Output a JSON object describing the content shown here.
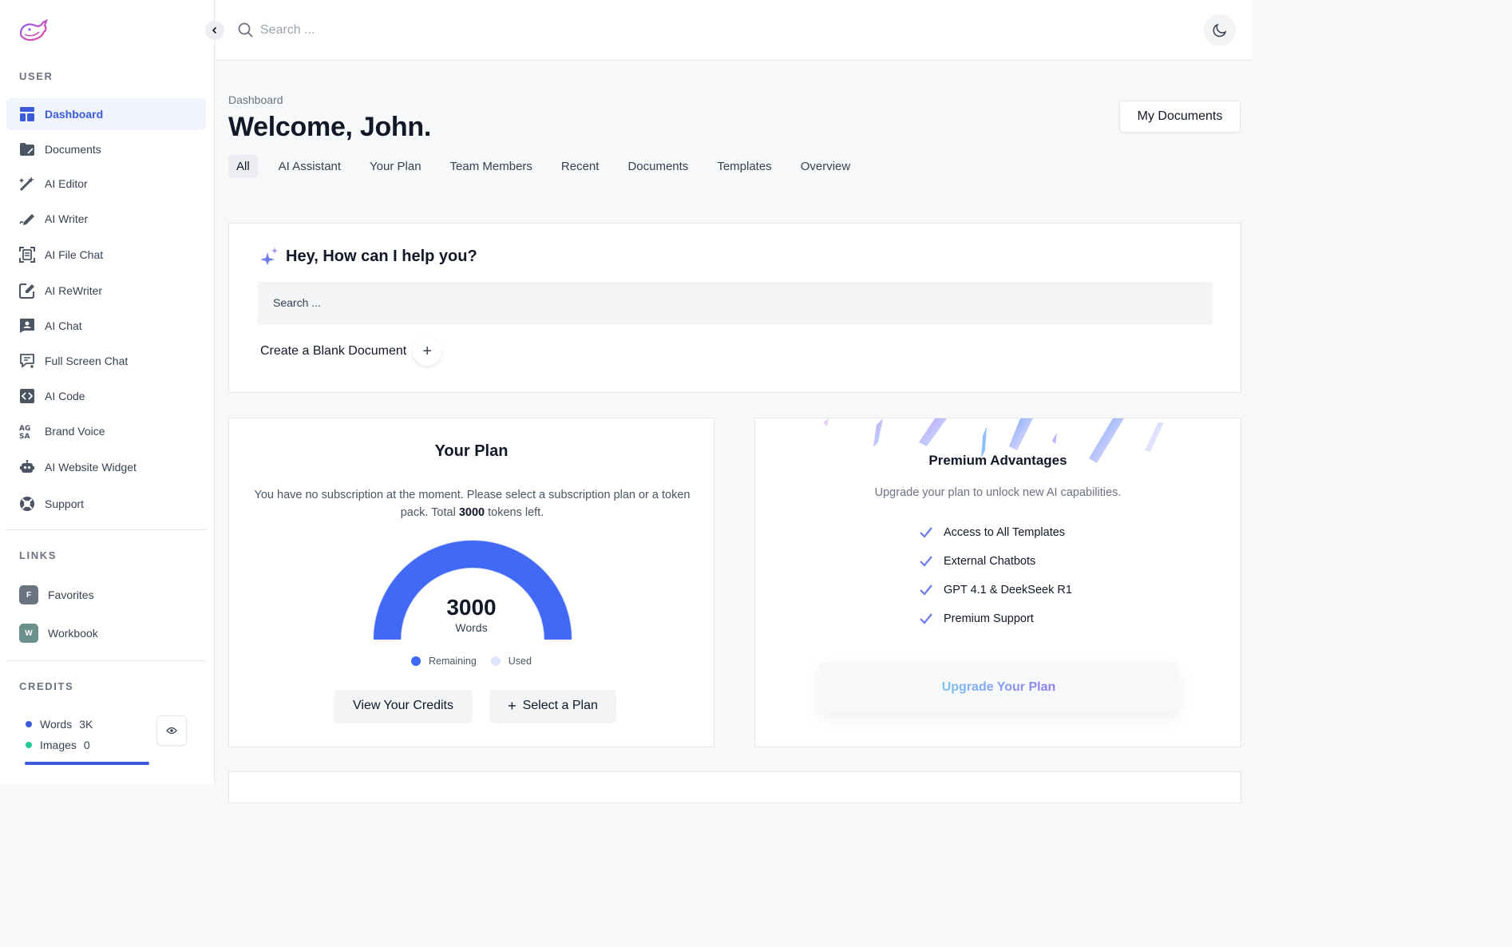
{
  "sidebar": {
    "user_label": "USER",
    "items": [
      {
        "label": "Dashboard",
        "icon": "dashboard-icon"
      },
      {
        "label": "Documents",
        "icon": "folder-icon"
      },
      {
        "label": "AI Editor",
        "icon": "magic-wand-icon"
      },
      {
        "label": "AI Writer",
        "icon": "pen-icon"
      },
      {
        "label": "AI File Chat",
        "icon": "file-scan-icon"
      },
      {
        "label": "AI ReWriter",
        "icon": "edit-icon"
      },
      {
        "label": "AI Chat",
        "icon": "chat-user-icon"
      },
      {
        "label": "Full Screen Chat",
        "icon": "chat-plus-icon"
      },
      {
        "label": "AI Code",
        "icon": "code-icon"
      },
      {
        "label": "Brand Voice",
        "icon": "typography-icon"
      },
      {
        "label": "AI Website Widget",
        "icon": "robot-icon"
      },
      {
        "label": "Support",
        "icon": "lifebuoy-icon"
      }
    ],
    "links_label": "LINKS",
    "links": [
      {
        "letter": "F",
        "label": "Favorites",
        "color": "#6b7280"
      },
      {
        "letter": "W",
        "label": "Workbook",
        "color": "#6b8f8a"
      }
    ],
    "credits_label": "CREDITS",
    "credits": [
      {
        "label": "Words",
        "value": "3K",
        "color": "#3b5bdb"
      },
      {
        "label": "Images",
        "value": "0",
        "color": "#20c997"
      }
    ],
    "credit_progress": 1.0
  },
  "header": {
    "search_placeholder": "Search ..."
  },
  "main": {
    "breadcrumb": "Dashboard",
    "title": "Welcome, John.",
    "my_documents_label": "My Documents",
    "tabs": [
      "All",
      "AI Assistant",
      "Your Plan",
      "Team Members",
      "Recent",
      "Documents",
      "Templates",
      "Overview"
    ]
  },
  "help": {
    "title": "Hey, How can I help you?",
    "search_placeholder": "Search ...",
    "blank_doc_label": "Create a Blank Document"
  },
  "plan": {
    "title": "Your Plan",
    "desc_1": "You have no subscription at the moment. Please select a subscription plan or a token pack. Total ",
    "tokens": "3000",
    "desc_2": " tokens left.",
    "gauge_value": "3000",
    "gauge_unit": "Words",
    "remaining_fraction": 1.0,
    "legend_remaining": "Remaining",
    "legend_used": "Used",
    "remaining_color": "#4169f5",
    "used_color": "#dde4fd",
    "view_credits_label": "View Your Credits",
    "select_plan_label": "Select a Plan"
  },
  "advantages": {
    "title": "Premium Advantages",
    "subtitle": "Upgrade your plan to unlock new AI capabilities.",
    "items": [
      "Access to All Templates",
      "External Chatbots",
      "GPT 4.1 & DeekSeek R1",
      "Premium Support"
    ],
    "upgrade_label": "Upgrade Your Plan",
    "check_color": "#6c7be8"
  }
}
